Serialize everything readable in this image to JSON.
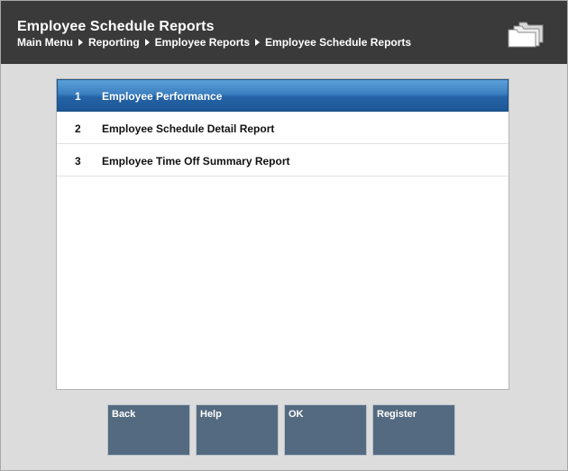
{
  "header": {
    "title": "Employee Schedule Reports",
    "breadcrumb": [
      "Main Menu",
      "Reporting",
      "Employee Reports",
      "Employee Schedule Reports"
    ],
    "icon": "folder-stack-icon"
  },
  "menu": {
    "items": [
      {
        "number": "1",
        "label": "Employee Performance",
        "selected": true
      },
      {
        "number": "2",
        "label": "Employee Schedule Detail Report",
        "selected": false
      },
      {
        "number": "3",
        "label": "Employee Time Off Summary Report",
        "selected": false
      }
    ]
  },
  "buttons": {
    "back": "Back",
    "help": "Help",
    "ok": "OK",
    "register": "Register"
  },
  "colors": {
    "header_bg": "#3a3a3a",
    "selected_row": "#2f6fb2",
    "button_bg": "#546a80",
    "panel_bg": "#dcdcdc"
  }
}
